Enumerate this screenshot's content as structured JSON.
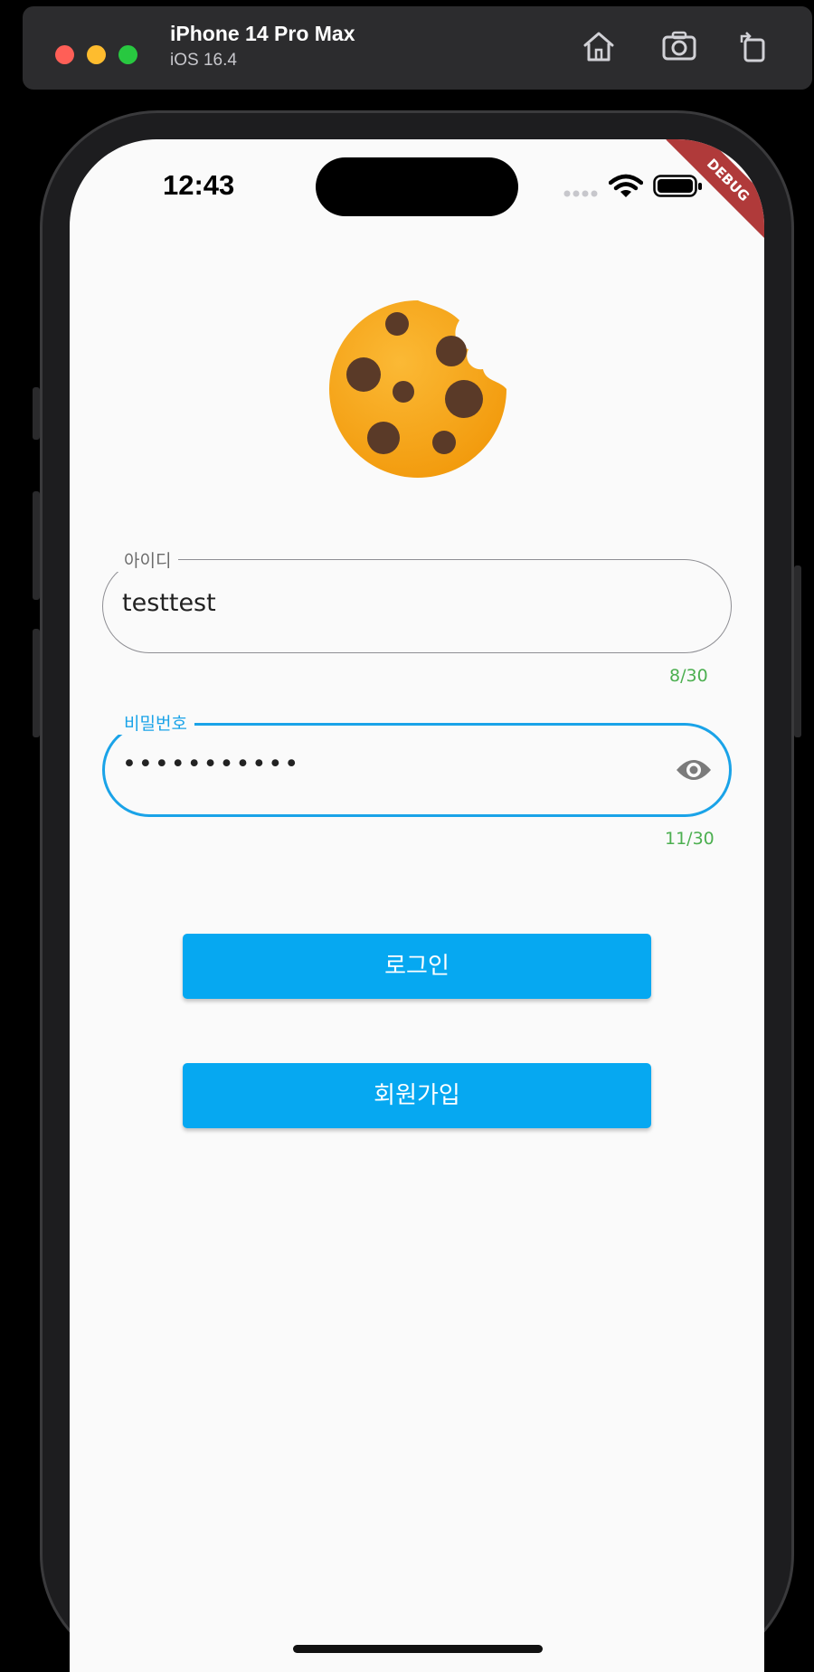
{
  "simulator": {
    "device_name": "iPhone 14 Pro Max",
    "os_version": "iOS 16.4",
    "toolbar_icons": [
      "home-icon",
      "screenshot-icon",
      "rotate-icon"
    ]
  },
  "status_bar": {
    "time": "12:43",
    "icons": [
      "signal-icon",
      "wifi-icon",
      "battery-icon"
    ]
  },
  "debug_banner": "DEBUG",
  "logo": "cookie-icon",
  "form": {
    "id_label": "아이디",
    "id_value": "testtest",
    "id_counter": "8/30",
    "password_label": "비밀번호",
    "password_value": "•••••••••••",
    "password_counter": "11/30"
  },
  "buttons": {
    "login": "로그인",
    "signup": "회원가입"
  },
  "colors": {
    "primary": "#06a8f1",
    "counter": "#4caf50",
    "debug": "#b03a3a",
    "cookie": "#f7a51c"
  }
}
